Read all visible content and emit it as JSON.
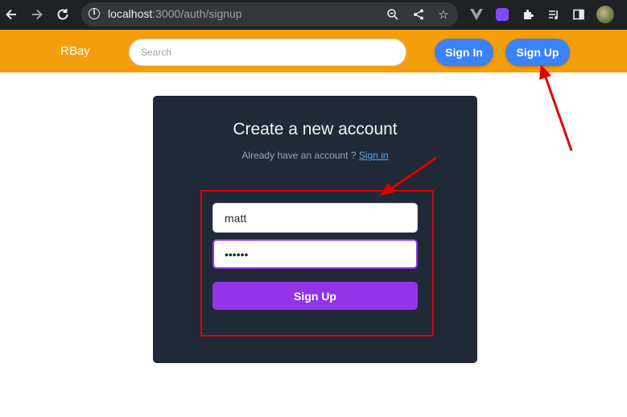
{
  "browser": {
    "url_host": "localhost",
    "url_rest": ":3000/auth/signup",
    "icons": [
      "back-arrow-icon",
      "forward-arrow-icon",
      "reload-icon",
      "info-icon",
      "zoom-icon",
      "share-icon",
      "star-icon",
      "vue-extension-icon",
      "extension-badge-icon",
      "puzzle-icon",
      "media-icon",
      "sidebar-icon",
      "profile-avatar"
    ]
  },
  "navbar": {
    "brand": "RBay",
    "search_placeholder": "Search",
    "sign_in_label": "Sign In",
    "sign_up_label": "Sign Up",
    "color": "#f59e0b",
    "button_color": "#3b82f6"
  },
  "form": {
    "title": "Create a new account",
    "subtitle": "Already have an account ?",
    "signin_link": "Sign in",
    "username_value": "matt",
    "password_value": "••••••",
    "submit_label": "Sign Up",
    "card_color": "#1f2937",
    "submit_color": "#9333ea"
  },
  "annotations": {
    "color": "#e00000"
  }
}
